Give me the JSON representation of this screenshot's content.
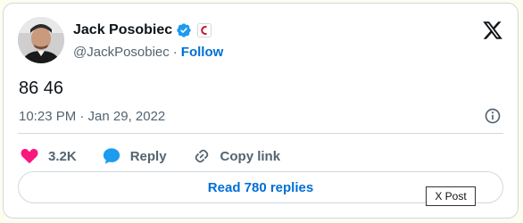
{
  "author": {
    "display_name": "Jack Posobiec",
    "handle": "@JackPosobiec",
    "separator": "·",
    "follow_label": "Follow"
  },
  "tweet": {
    "text": "86 46",
    "timestamp": "10:23 PM · Jan 29, 2022"
  },
  "actions": {
    "likes": "3.2K",
    "reply_label": "Reply",
    "copy_link_label": "Copy link"
  },
  "read_replies_label": "Read 780 replies",
  "tooltip_label": "X Post",
  "colors": {
    "like_red": "#f91880",
    "verified_blue": "#1d9bf0",
    "link_blue": "#006fd6"
  }
}
